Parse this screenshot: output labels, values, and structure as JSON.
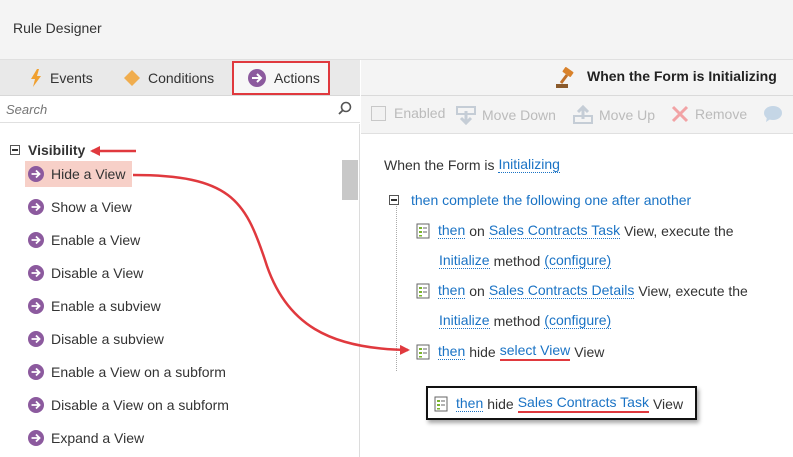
{
  "window": {
    "title": "Rule Designer"
  },
  "tabs": [
    {
      "label": "Events"
    },
    {
      "label": "Conditions"
    },
    {
      "label": "Actions"
    }
  ],
  "search": {
    "placeholder": "Search"
  },
  "tree": {
    "group_label": "Visibility",
    "items": [
      {
        "label": "Hide a View"
      },
      {
        "label": "Show a View"
      },
      {
        "label": "Enable a View"
      },
      {
        "label": "Disable a View"
      },
      {
        "label": "Enable a subview"
      },
      {
        "label": "Disable a subview"
      },
      {
        "label": "Enable a View on a subform"
      },
      {
        "label": "Disable a View on a subform"
      },
      {
        "label": "Expand a View"
      }
    ]
  },
  "rule_header": {
    "title": "When the Form is Initializing"
  },
  "toolbar": {
    "enabled": "Enabled",
    "move_down": "Move Down",
    "move_up": "Move Up",
    "remove": "Remove"
  },
  "rule": {
    "event_prefix": "When the Form is",
    "event_link": "Initializing",
    "block_label": "then complete the following one after another",
    "row1": {
      "then": "then",
      "on": "on",
      "view": "Sales Contracts Task",
      "mid": "View, execute the",
      "method": "Initialize",
      "method_word": "method",
      "configure": "(configure)"
    },
    "row2": {
      "then": "then",
      "on": "on",
      "view": "Sales Contracts Details",
      "mid": "View, execute the",
      "method": "Initialize",
      "method_word": "method",
      "configure": "(configure)"
    },
    "row3": {
      "then": "then",
      "hide": "hide",
      "select": "select View",
      "view_word": "View"
    },
    "result": {
      "then": "then",
      "hide": "hide",
      "view": "Sales Contracts Task",
      "view_word": "View"
    }
  },
  "colors": {
    "accent_red": "#e0393e",
    "link_blue": "#1a73c5",
    "action_purple": "#8c5a9e",
    "diamond_orange": "#f0ad4e"
  }
}
